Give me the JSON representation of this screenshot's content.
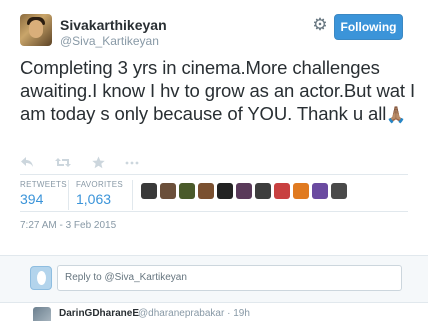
{
  "author": {
    "name": "Sivakarthikeyan",
    "handle": "@Siva_Kartikeyan"
  },
  "header": {
    "follow_label": "Following",
    "gear_icon": "gear-icon"
  },
  "tweet": {
    "text": "Completing 3 yrs in cinema.More challenges awaiting.I know I hv to grow as an actor.But wat I am today s only because of YOU. Thank u all",
    "emoji": "🙏🏽"
  },
  "actions": {
    "reply_icon": "reply-icon",
    "retweet_icon": "retweet-icon",
    "favorite_icon": "star-icon",
    "more_icon": "more-icon"
  },
  "stats": {
    "retweets_label": "RETWEETS",
    "retweets_value": "394",
    "favorites_label": "FAVORITES",
    "favorites_value": "1,063"
  },
  "favoriters": {
    "colors": [
      "#3a3a3a",
      "#6b4f3a",
      "#4a5a2a",
      "#7a5030",
      "#222222",
      "#5a3a5a",
      "#3d3d3d",
      "#c84040",
      "#e07a20",
      "#6a4aa0",
      "#4a4a4a"
    ]
  },
  "timestamp": "7:27 AM - 3 Feb 2015",
  "reply": {
    "placeholder": "Reply to @Siva_Kartikeyan"
  },
  "next_tweet": {
    "name": "DarinGDharaneE",
    "handle": "@dharaneprabakar · 19h"
  },
  "colors": {
    "accent": "#3b94d9",
    "muted": "#8899a6",
    "text": "#292f33"
  }
}
